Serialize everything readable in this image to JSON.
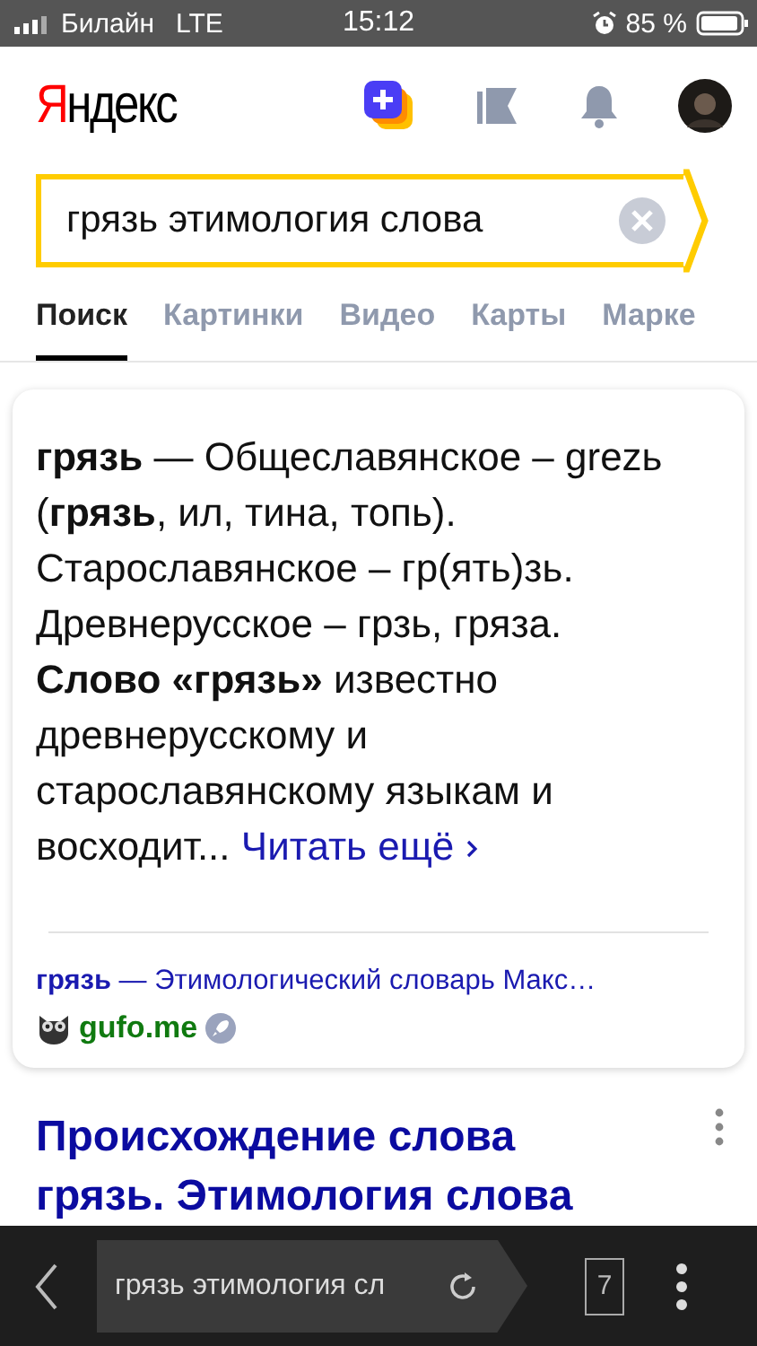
{
  "status_bar": {
    "carrier": "Билайн",
    "network": "LTE",
    "time": "15:12",
    "battery": "85 %"
  },
  "header": {
    "logo": "Яндекс"
  },
  "search": {
    "value": "грязь этимология слова"
  },
  "tabs": [
    {
      "label": "Поиск",
      "selected": true
    },
    {
      "label": "Картинки",
      "selected": false
    },
    {
      "label": "Видео",
      "selected": false
    },
    {
      "label": "Карты",
      "selected": false
    },
    {
      "label": "Марке",
      "selected": false
    }
  ],
  "snippet": {
    "text": "**грязь** — Общеславянское – grezь (**грязь**, ил, тина, топь). Старославянское – гр(ять)зь. Древнерусское – грзь, гряза. **Слово «грязь»** известно древнерусскому и старославянскому языкам и восходит...",
    "more": "Читать ещё",
    "source_title": "**грязь** — Этимологический словарь Макс…",
    "source_site": "gufo.me"
  },
  "result": {
    "title": "Происхождение слова грязь. Этимология слова"
  },
  "bottom_bar": {
    "address": "грязь этимология сл",
    "tab_count": "7"
  }
}
